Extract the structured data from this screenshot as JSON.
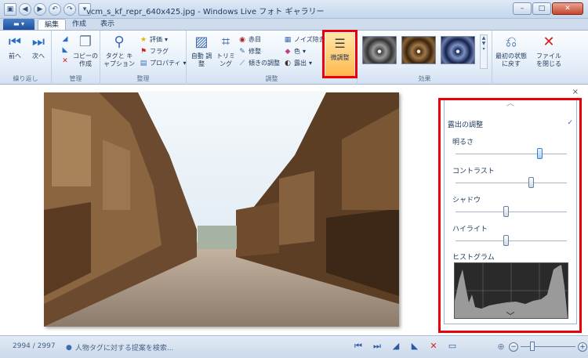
{
  "window": {
    "title": "vcm_s_kf_repr_640x425.jpg - Windows Live フォト ギャラリー",
    "minimize": "–",
    "maximize": "□",
    "close": "✕"
  },
  "qat": {
    "back": "◀",
    "forward": "▶",
    "undo": "↶",
    "redo": "↷",
    "more": "▾"
  },
  "tabs": [
    "編集",
    "作成",
    "表示"
  ],
  "app_menu": "▬ ▾",
  "ribbon": {
    "groups": {
      "nav": "繰り返し",
      "manage": "管理",
      "organize": "整理",
      "adjust": "調整",
      "effects": "効果"
    },
    "prev": "前へ",
    "next": "次へ",
    "copy": "コピーの作成",
    "tags": "タグと キャプション",
    "rating": "評価",
    "flag": "フラグ",
    "properties": "プロパティ",
    "auto": "自動 調整",
    "trim": "トリミ ング",
    "redeye": "赤目",
    "retouch": "修整",
    "straighten": "傾きの調整",
    "noise": "ノイズ除去",
    "color": "色",
    "exposure": "露出",
    "fine": "微調整",
    "revert": "最初の状態 に戻す",
    "close_file": "ファイル を閉じる"
  },
  "panel": {
    "title": "露出の調整",
    "check": "✓",
    "collapse": "︿",
    "expand": "﹀",
    "close": "×",
    "sliders": [
      {
        "label": "明るさ",
        "value": 0.76
      },
      {
        "label": "コントラスト",
        "value": 0.68
      },
      {
        "label": "シャドウ",
        "value": 0.46
      },
      {
        "label": "ハイライト",
        "value": 0.46
      }
    ],
    "histogram_label": "ヒストグラム"
  },
  "status": {
    "count": "2994 / 2997",
    "hint": "人物タグに対する提案を検索...",
    "zoom_minus": "−",
    "zoom_plus": "+"
  },
  "colors": {
    "highlight": "#e8000b",
    "fine_button": "#ffb84c",
    "ribbon_text": "#1e395b"
  }
}
